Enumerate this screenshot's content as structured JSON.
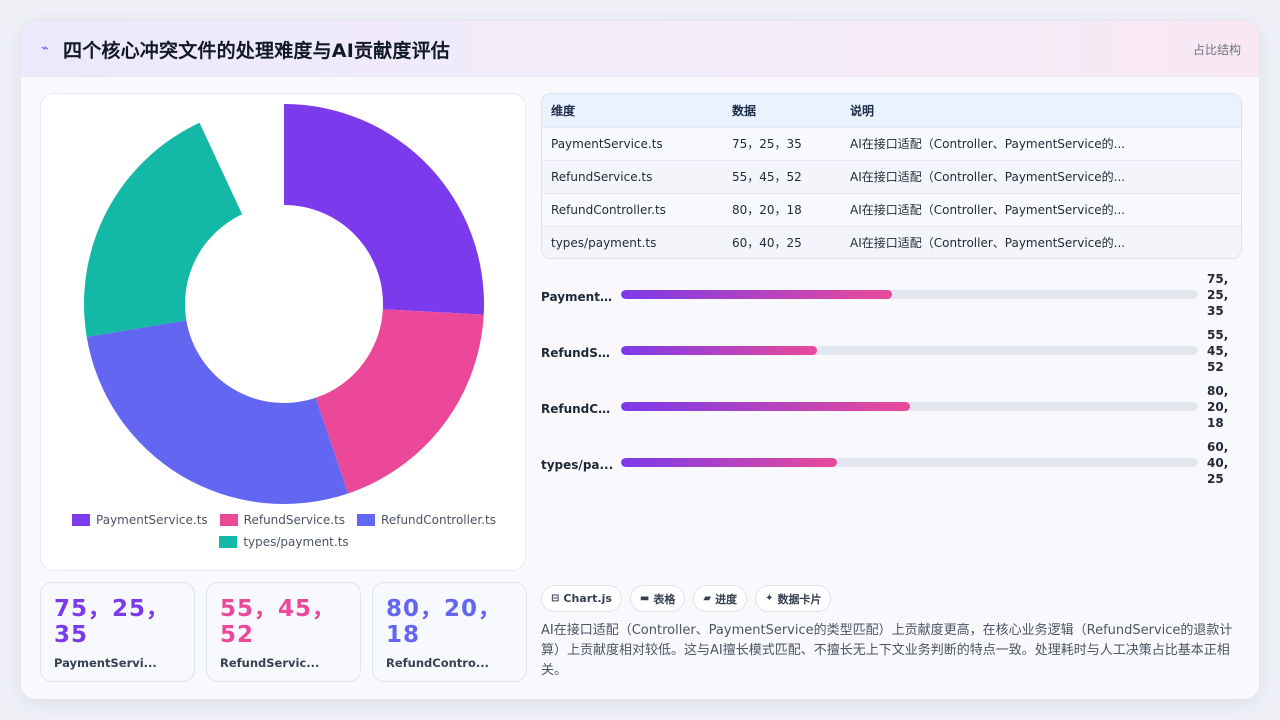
{
  "header": {
    "title": "四个核心冲突文件的处理难度与AI贡献度评估",
    "badge": "占比结构",
    "logo_icon": "trend-icon"
  },
  "colors": {
    "purple": "#7c3aed",
    "pink": "#ec4899",
    "indigo": "#6366f1",
    "teal": "#14b8a6"
  },
  "chart_data": [
    {
      "type": "pie",
      "variant": "doughnut",
      "labels": [
        "PaymentService.ts",
        "RefundService.ts",
        "RefundController.ts",
        "types/payment.ts"
      ],
      "values": [
        75,
        55,
        80,
        60
      ],
      "colors": [
        "#7c3aed",
        "#ec4899",
        "#6366f1",
        "#14b8a6"
      ],
      "legend_position": "bottom",
      "note": "Gap in the ring between the last and first slice; slice angles follow values"
    },
    {
      "type": "bar",
      "orientation": "horizontal",
      "categories": [
        "PaymentS...",
        "RefundSe...",
        "RefundCo...",
        "types/pa..."
      ],
      "value_labels": [
        "75,\n25,\n35",
        "55,\n45,\n52",
        "80,\n20,\n18",
        "60,\n40,\n25"
      ],
      "fill_fraction": [
        0.47,
        0.34,
        0.5,
        0.375
      ]
    }
  ],
  "table": {
    "headers": [
      "维度",
      "数据",
      "说明"
    ],
    "rows": [
      [
        "PaymentService.ts",
        "75，25，35",
        "AI在接口适配（Controller、PaymentService的..."
      ],
      [
        "RefundService.ts",
        "55，45，52",
        "AI在接口适配（Controller、PaymentService的..."
      ],
      [
        "RefundController.ts",
        "80，20，18",
        "AI在接口适配（Controller、PaymentService的..."
      ],
      [
        "types/payment.ts",
        "60，40，25",
        "AI在接口适配（Controller、PaymentService的..."
      ]
    ]
  },
  "stats": [
    {
      "value": "75，25，35",
      "label": "PaymentServi...",
      "color": "#7c3aed"
    },
    {
      "value": "55，45，52",
      "label": "RefundServic...",
      "color": "#ec4899"
    },
    {
      "value": "80，20，18",
      "label": "RefundContro...",
      "color": "#6366f1"
    }
  ],
  "tags": [
    {
      "icon": "chart-icon",
      "glyph": "⊟",
      "label": "Chart.js"
    },
    {
      "icon": "table-icon",
      "glyph": "▬",
      "label": "表格"
    },
    {
      "icon": "progress-icon",
      "glyph": "▰",
      "label": "进度"
    },
    {
      "icon": "sparkle-icon",
      "glyph": "✦",
      "label": "数据卡片"
    }
  ],
  "summary": "AI在接口适配（Controller、PaymentService的类型匹配）上贡献度更高，在核心业务逻辑（RefundService的退款计算）上贡献度相对较低。这与AI擅长模式匹配、不擅长无上下文业务判断的特点一致。处理耗时与人工决策占比基本正相关。"
}
